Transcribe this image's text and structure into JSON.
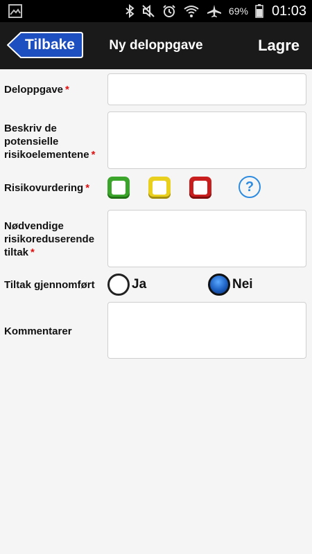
{
  "status_bar": {
    "battery_pct": "69%",
    "time": "01:03",
    "icons": [
      "image-icon",
      "bluetooth-icon",
      "mute-icon",
      "alarm-icon",
      "wifi-icon",
      "airplane-icon",
      "battery-icon"
    ]
  },
  "title_bar": {
    "back_label": "Tilbake",
    "title": "Ny deloppgave",
    "save_label": "Lagre",
    "colors": {
      "background": "#1a1a1a",
      "back_button": "#1d4fc1"
    }
  },
  "form": {
    "deloppgave": {
      "label": "Deloppgave",
      "required": "*",
      "value": ""
    },
    "beskriv": {
      "label": "Beskriv de potensielle risikoelementene",
      "required": "*",
      "value": ""
    },
    "risikovurdering": {
      "label": "Risikovurdering",
      "required": "*",
      "options": [
        "green",
        "yellow",
        "red"
      ],
      "help": "?",
      "colors": {
        "green": "#3aa52a",
        "yellow": "#e9cf1e",
        "red": "#c81e1e",
        "help": "#2c8be0"
      }
    },
    "tiltak": {
      "label": "Nødvendige risikoreduserende tiltak",
      "required": "*",
      "value": ""
    },
    "gjennomfort": {
      "label": "Tiltak gjennomført",
      "yes_label": "Ja",
      "no_label": "Nei",
      "selected": "Nei"
    },
    "kommentarer": {
      "label": "Kommentarer",
      "value": ""
    }
  }
}
